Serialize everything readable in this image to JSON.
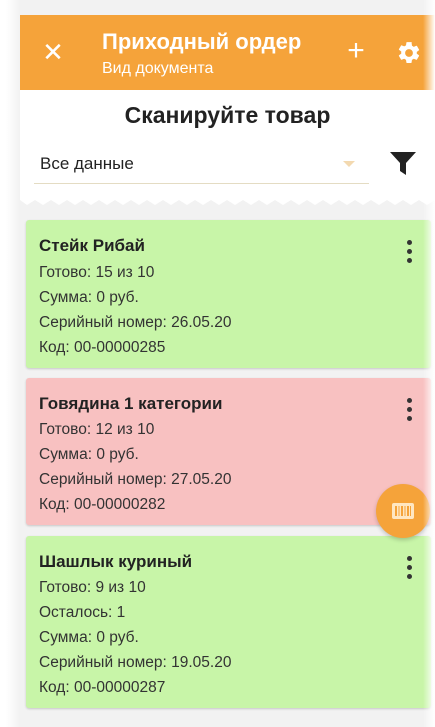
{
  "appbar": {
    "title": "Приходный ордер",
    "subtitle": "Вид документа",
    "close_icon": "close-icon",
    "add_icon": "plus-icon",
    "settings_icon": "gear-icon"
  },
  "header": {
    "scan_title": "Сканируйте товар",
    "filter": {
      "selected": "Все данные"
    },
    "filter_icon": "funnel-icon"
  },
  "cards": [
    {
      "status": "ok",
      "color": "#c8f5a8",
      "name": "Стейк Рибай",
      "lines": [
        "Готово: 15 из 10",
        "Сумма: 0 руб.",
        "Серийный номер: 26.05.20",
        "Код: 00-00000285"
      ]
    },
    {
      "status": "error",
      "color": "#f8c1c1",
      "name": "Говядина 1 категории",
      "lines": [
        "Готово: 12 из 10",
        "Сумма: 0 руб.",
        "Серийный номер: 27.05.20",
        "Код: 00-00000282"
      ]
    },
    {
      "status": "ok",
      "color": "#c8f5a8",
      "name": "Шашлык куриный",
      "lines": [
        "Готово: 9 из 10",
        "Осталось: 1",
        "Сумма: 0 руб.",
        "Серийный номер: 19.05.20",
        "Код: 00-00000287"
      ]
    }
  ],
  "fab": {
    "icon": "barcode-scan-icon"
  },
  "colors": {
    "accent": "#f5a33a",
    "ok": "#c8f5a8",
    "error": "#f8c1c1"
  }
}
